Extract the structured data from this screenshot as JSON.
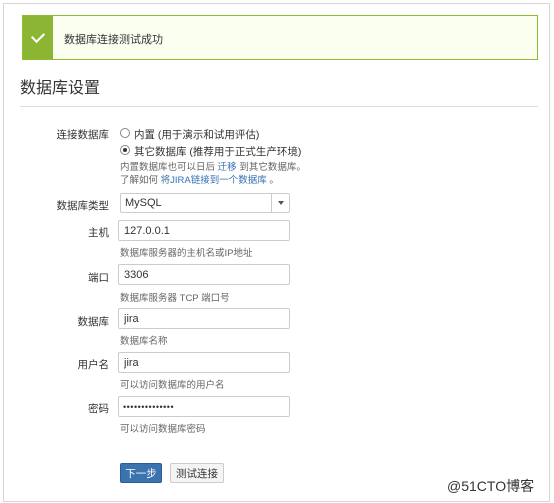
{
  "banner": {
    "message": "数据库连接测试成功"
  },
  "page_title": "数据库设置",
  "connection": {
    "label": "连接数据库",
    "option_builtin": "内置 (用于演示和试用评估)",
    "option_other": "其它数据库 (推荐用于正式生产环境)",
    "hint_line1_prefix": "内置数据库也可以日后",
    "hint_line1_link": "迁移",
    "hint_line1_suffix": "到其它数据库。",
    "hint_line2_prefix": "了解如何",
    "hint_line2_link": "将JIRA链接到一个数据库",
    "hint_line2_suffix": "。"
  },
  "db_type": {
    "label": "数据库类型",
    "value": "MySQL"
  },
  "host": {
    "label": "主机",
    "value": "127.0.0.1",
    "hint": "数据库服务器的主机名或IP地址"
  },
  "port": {
    "label": "端口",
    "value": "3306",
    "hint": "数据库服务器 TCP 端口号"
  },
  "database": {
    "label": "数据库",
    "value": "jira",
    "hint": "数据库名称"
  },
  "username": {
    "label": "用户名",
    "value": "jira",
    "hint": "可以访问数据库的用户名"
  },
  "password": {
    "label": "密码",
    "masked": "••••••••••••••",
    "hint": "可以访问数据库密码"
  },
  "buttons": {
    "next": "下一步",
    "test": "测试连接"
  },
  "watermark": "@51CTO博客"
}
